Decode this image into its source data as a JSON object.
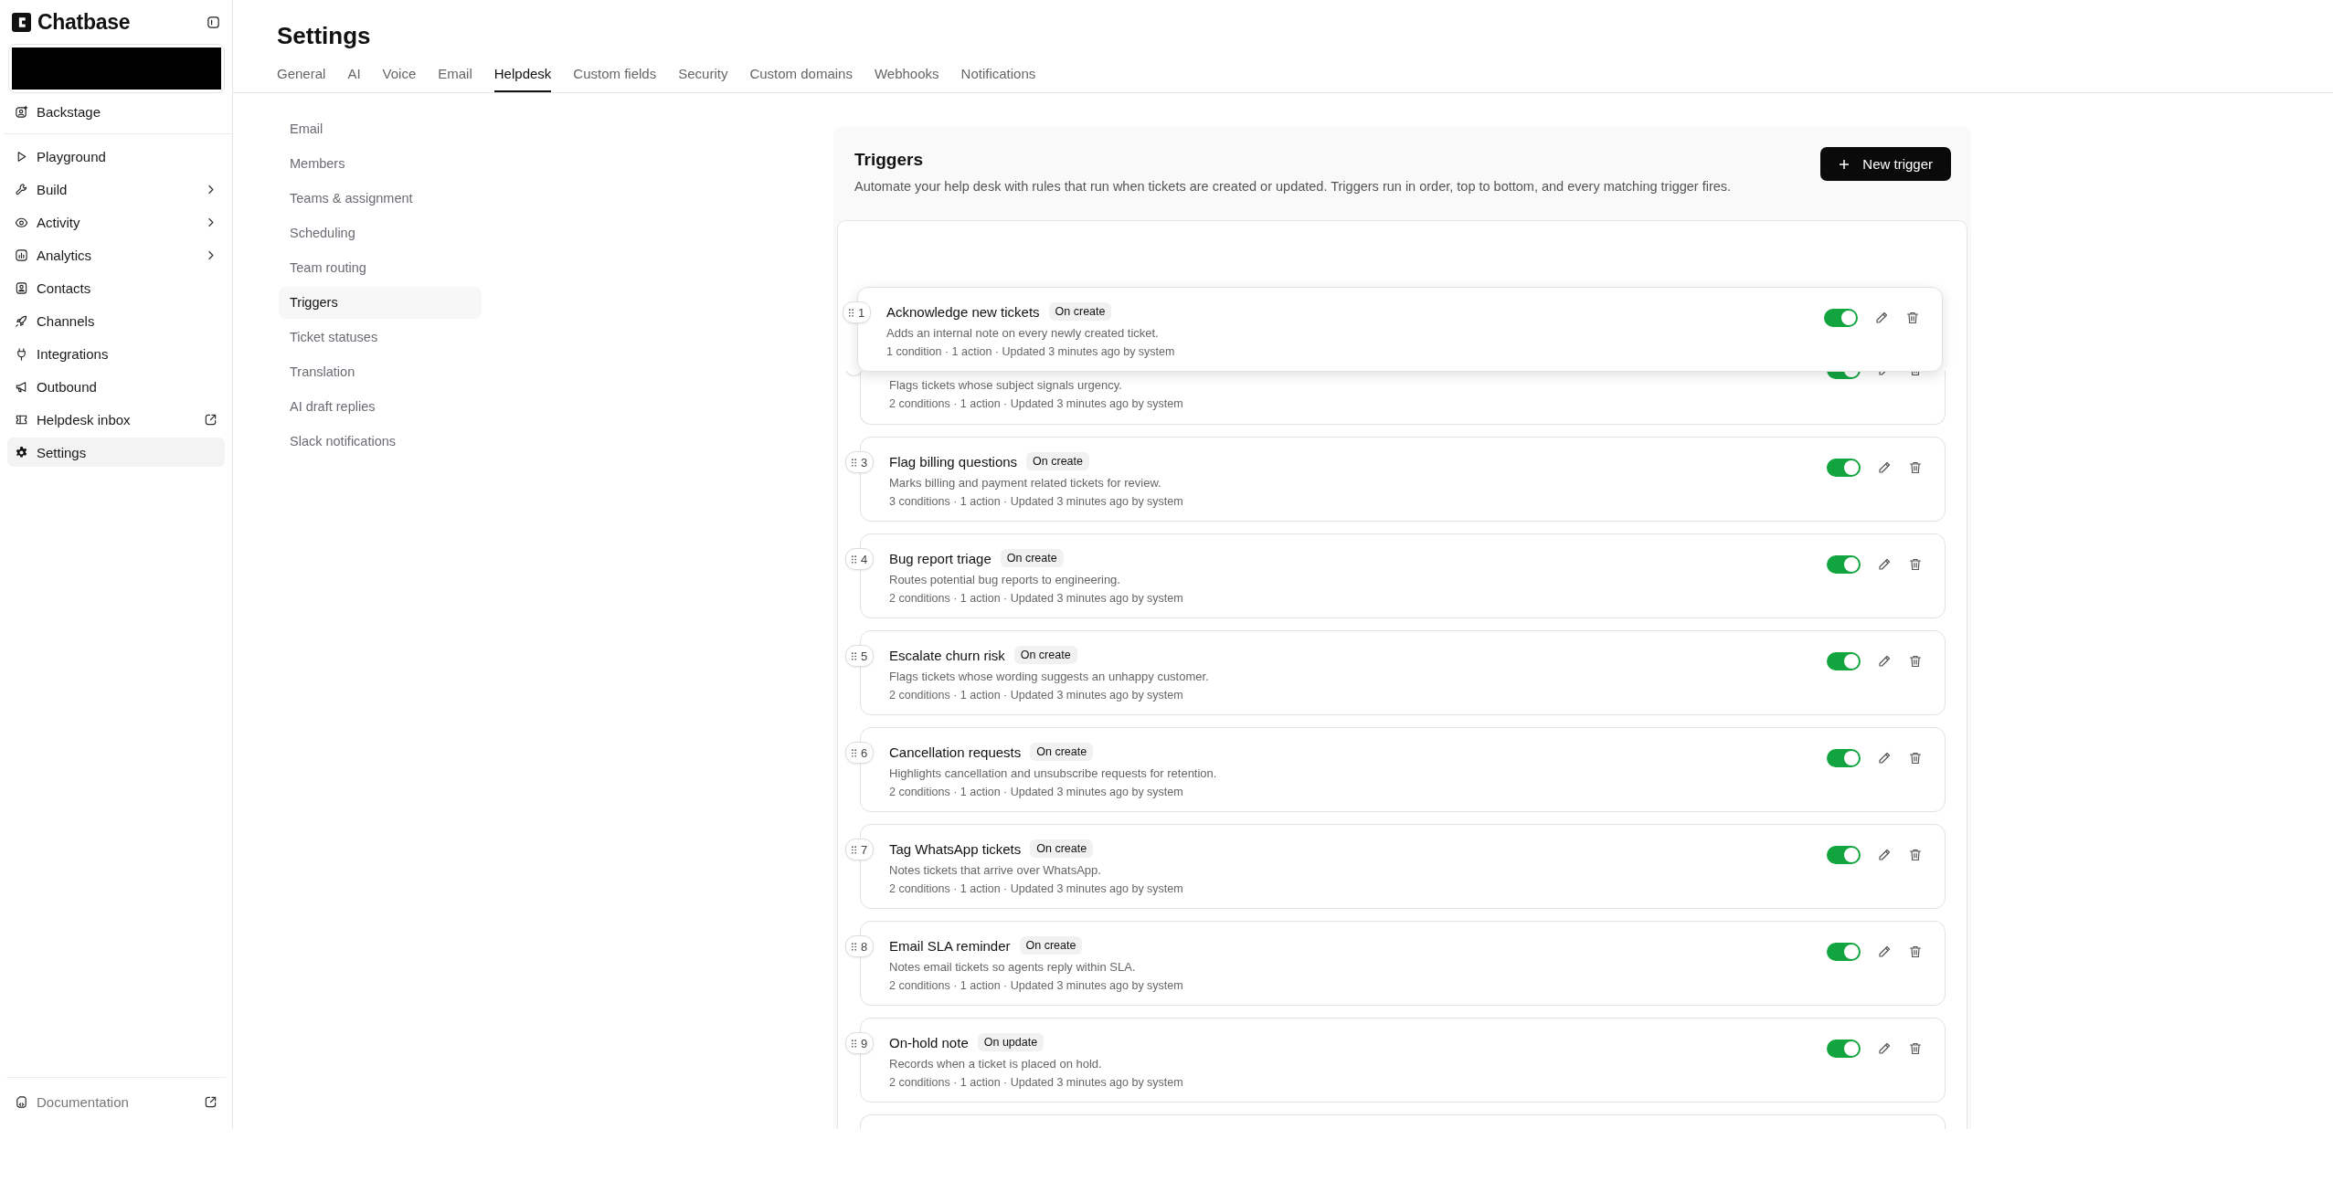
{
  "brand": {
    "name": "Chatbase"
  },
  "sidebar": {
    "items": [
      {
        "label": "Backstage",
        "selected": false
      },
      {
        "label": "Playground",
        "selected": false
      },
      {
        "label": "Build",
        "selected": false,
        "expandable": true
      },
      {
        "label": "Activity",
        "selected": false,
        "expandable": true
      },
      {
        "label": "Analytics",
        "selected": false,
        "expandable": true
      },
      {
        "label": "Contacts",
        "selected": false
      },
      {
        "label": "Channels",
        "selected": false
      },
      {
        "label": "Integrations",
        "selected": false
      },
      {
        "label": "Outbound",
        "selected": false
      },
      {
        "label": "Helpdesk inbox",
        "selected": false,
        "external": true
      },
      {
        "label": "Settings",
        "selected": true
      }
    ],
    "footer": {
      "label": "Documentation",
      "external": true
    }
  },
  "page": {
    "title": "Settings"
  },
  "tabs": [
    {
      "label": "General",
      "selected": false
    },
    {
      "label": "AI",
      "selected": false
    },
    {
      "label": "Voice",
      "selected": false
    },
    {
      "label": "Email",
      "selected": false
    },
    {
      "label": "Helpdesk",
      "selected": true
    },
    {
      "label": "Custom fields",
      "selected": false
    },
    {
      "label": "Security",
      "selected": false
    },
    {
      "label": "Custom domains",
      "selected": false
    },
    {
      "label": "Webhooks",
      "selected": false
    },
    {
      "label": "Notifications",
      "selected": false
    }
  ],
  "subnav": [
    {
      "label": "Email",
      "selected": false
    },
    {
      "label": "Members",
      "selected": false
    },
    {
      "label": "Teams & assignment",
      "selected": false
    },
    {
      "label": "Scheduling",
      "selected": false
    },
    {
      "label": "Team routing",
      "selected": false
    },
    {
      "label": "Triggers",
      "selected": true
    },
    {
      "label": "Ticket statuses",
      "selected": false
    },
    {
      "label": "Translation",
      "selected": false
    },
    {
      "label": "AI draft replies",
      "selected": false
    },
    {
      "label": "Slack notifications",
      "selected": false
    }
  ],
  "triggers": {
    "title": "Triggers",
    "description": "Automate your help desk with rules that run when tickets are created or updated. Triggers run in order, top to bottom, and every matching trigger fires.",
    "new_button": "New trigger",
    "rows": [
      {
        "number": "1",
        "title": "Acknowledge new tickets",
        "event": "On create",
        "description": "Adds an internal note on every newly created ticket.",
        "meta": "1 condition · 1 action · Updated 3 minutes ago by system",
        "on": true,
        "dragging": true
      },
      {
        "description": "Flags tickets whose subject signals urgency.",
        "meta": "2 conditions · 1 action · Updated 3 minutes ago by system",
        "on": true,
        "dragging": false
      },
      {
        "number": "3",
        "title": "Flag billing questions",
        "event": "On create",
        "description": "Marks billing and payment related tickets for review.",
        "meta": "3 conditions · 1 action · Updated 3 minutes ago by system",
        "on": true,
        "dragging": false
      },
      {
        "number": "4",
        "title": "Bug report triage",
        "event": "On create",
        "description": "Routes potential bug reports to engineering.",
        "meta": "2 conditions · 1 action · Updated 3 minutes ago by system",
        "on": true,
        "dragging": false
      },
      {
        "number": "5",
        "title": "Escalate churn risk",
        "event": "On create",
        "description": "Flags tickets whose wording suggests an unhappy customer.",
        "meta": "2 conditions · 1 action · Updated 3 minutes ago by system",
        "on": true,
        "dragging": false
      },
      {
        "number": "6",
        "title": "Cancellation requests",
        "event": "On create",
        "description": "Highlights cancellation and unsubscribe requests for retention.",
        "meta": "2 conditions · 1 action · Updated 3 minutes ago by system",
        "on": true,
        "dragging": false
      },
      {
        "number": "7",
        "title": "Tag WhatsApp tickets",
        "event": "On create",
        "description": "Notes tickets that arrive over WhatsApp.",
        "meta": "2 conditions · 1 action · Updated 3 minutes ago by system",
        "on": true,
        "dragging": false
      },
      {
        "number": "8",
        "title": "Email SLA reminder",
        "event": "On create",
        "description": "Notes email tickets so agents reply within SLA.",
        "meta": "2 conditions · 1 action · Updated 3 minutes ago by system",
        "on": true,
        "dragging": false
      },
      {
        "number": "9",
        "title": "On-hold note",
        "event": "On update",
        "description": "Records when a ticket is placed on hold.",
        "meta": "2 conditions · 1 action · Updated 3 minutes ago by system",
        "on": true,
        "dragging": false
      }
    ]
  }
}
